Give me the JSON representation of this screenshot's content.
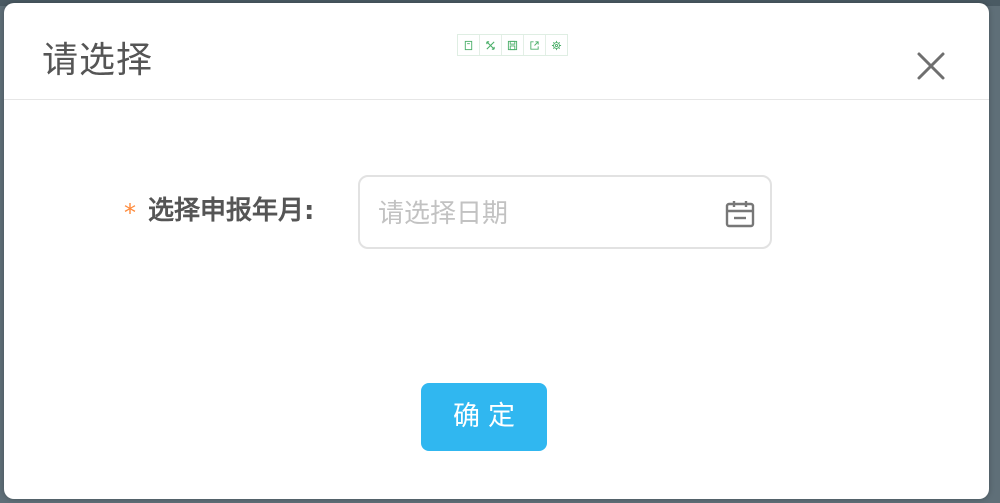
{
  "dialog": {
    "title": "请选择",
    "toolbar_icons": [
      "bookmark-icon",
      "expand-icon",
      "save-icon",
      "share-icon",
      "settings-icon"
    ],
    "close_icon": "close-icon"
  },
  "form": {
    "required_mark": "*",
    "label": "选择申报年月:",
    "date_placeholder": "请选择日期",
    "date_value": ""
  },
  "confirm_button": {
    "label": "确定"
  },
  "colors": {
    "accent": "#30b7f0",
    "required": "#ff8a3a",
    "toolbar_icon": "#4caf6a"
  }
}
